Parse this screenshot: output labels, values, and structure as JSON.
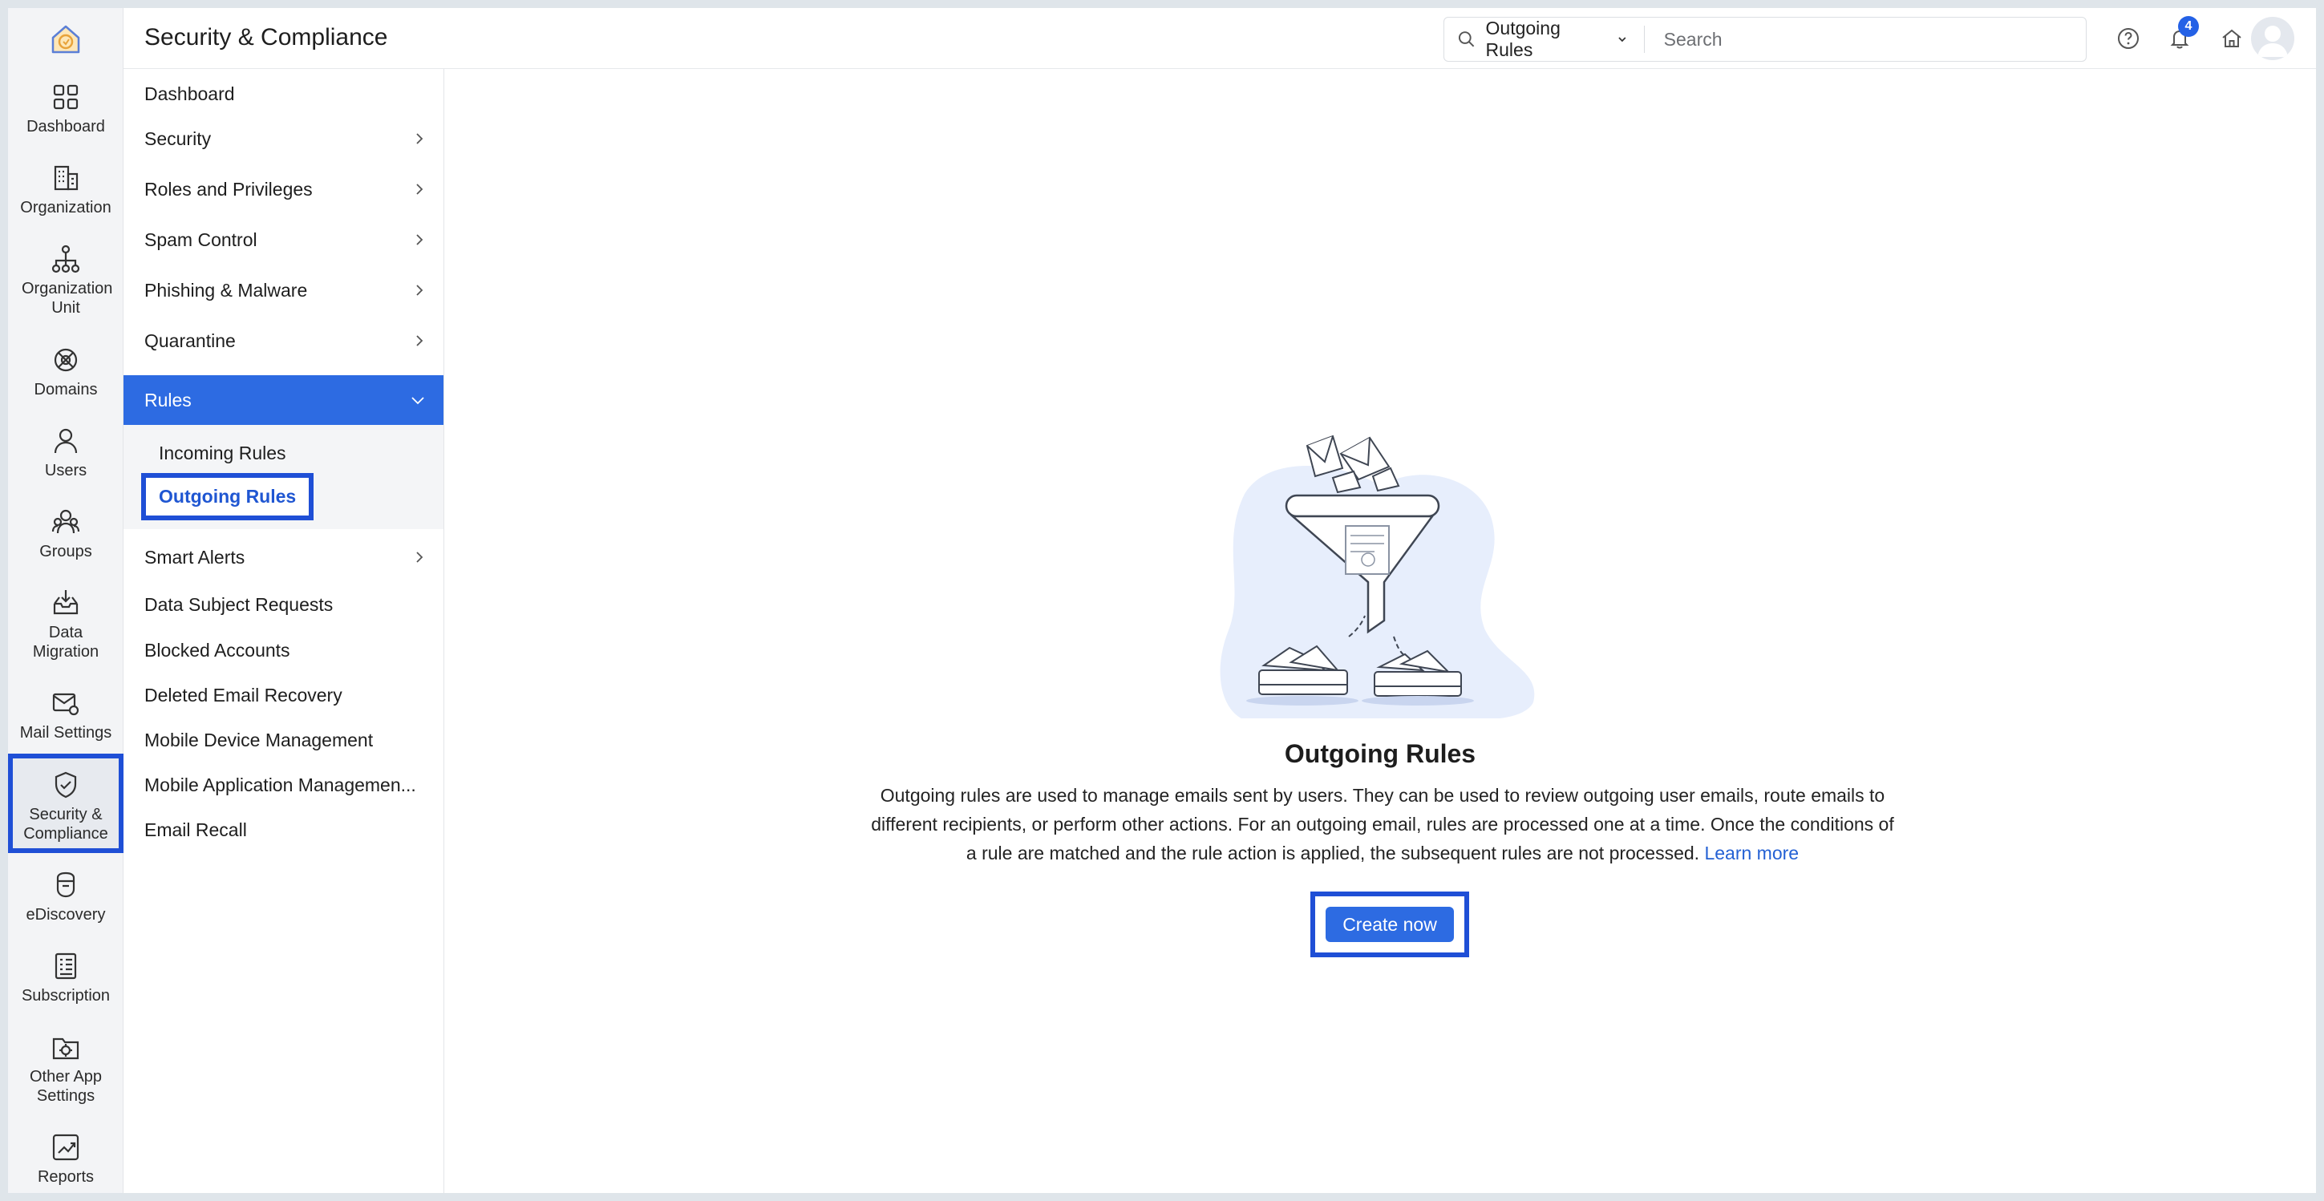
{
  "header": {
    "title": "Security & Compliance",
    "search_scope": "Outgoing Rules",
    "search_placeholder": "Search",
    "notification_count": "4"
  },
  "rail": [
    {
      "label": "Dashboard",
      "icon": "dashboard-icon"
    },
    {
      "label": "Organization",
      "icon": "organization-icon"
    },
    {
      "label": "Organization Unit",
      "icon": "org-unit-icon"
    },
    {
      "label": "Domains",
      "icon": "domains-icon"
    },
    {
      "label": "Users",
      "icon": "users-icon"
    },
    {
      "label": "Groups",
      "icon": "groups-icon"
    },
    {
      "label": "Data Migration",
      "icon": "data-migration-icon"
    },
    {
      "label": "Mail Settings",
      "icon": "mail-settings-icon"
    },
    {
      "label": "Security & Compliance",
      "icon": "shield-icon",
      "active": true
    },
    {
      "label": "eDiscovery",
      "icon": "ediscovery-icon"
    },
    {
      "label": "Subscription",
      "icon": "subscription-icon"
    },
    {
      "label": "Other App Settings",
      "icon": "app-settings-icon"
    },
    {
      "label": "Reports",
      "icon": "reports-icon"
    }
  ],
  "subnav": {
    "items": [
      {
        "label": "Dashboard",
        "has_children": false
      },
      {
        "label": "Security",
        "has_children": true
      },
      {
        "label": "Roles and Privileges",
        "has_children": true
      },
      {
        "label": "Spam Control",
        "has_children": true
      },
      {
        "label": "Phishing & Malware",
        "has_children": true
      },
      {
        "label": "Quarantine",
        "has_children": true
      },
      {
        "label": "Rules",
        "has_children": true,
        "expanded": true
      },
      {
        "label": "Smart Alerts",
        "has_children": true
      },
      {
        "label": "Data Subject Requests",
        "has_children": false
      },
      {
        "label": "Blocked Accounts",
        "has_children": false
      },
      {
        "label": "Deleted Email Recovery",
        "has_children": false
      },
      {
        "label": "Mobile Device Management",
        "has_children": false
      },
      {
        "label": "Mobile Application Managemen...",
        "has_children": false
      },
      {
        "label": "Email Recall",
        "has_children": false
      }
    ],
    "rules_children": [
      {
        "label": "Incoming Rules"
      },
      {
        "label": "Outgoing Rules",
        "active": true
      }
    ]
  },
  "empty_state": {
    "title": "Outgoing Rules",
    "description": "Outgoing rules are used to manage emails sent by users. They can be used to review outgoing user emails, route emails to different recipients, or perform other actions. For an outgoing email, rules are processed one at a time. Once the conditions of a rule are matched and the rule action is applied, the subsequent rules are not processed.",
    "learn_more": "Learn more",
    "button": "Create now"
  },
  "colors": {
    "accent": "#2d6be2",
    "highlight_border": "#1f4fd6"
  }
}
